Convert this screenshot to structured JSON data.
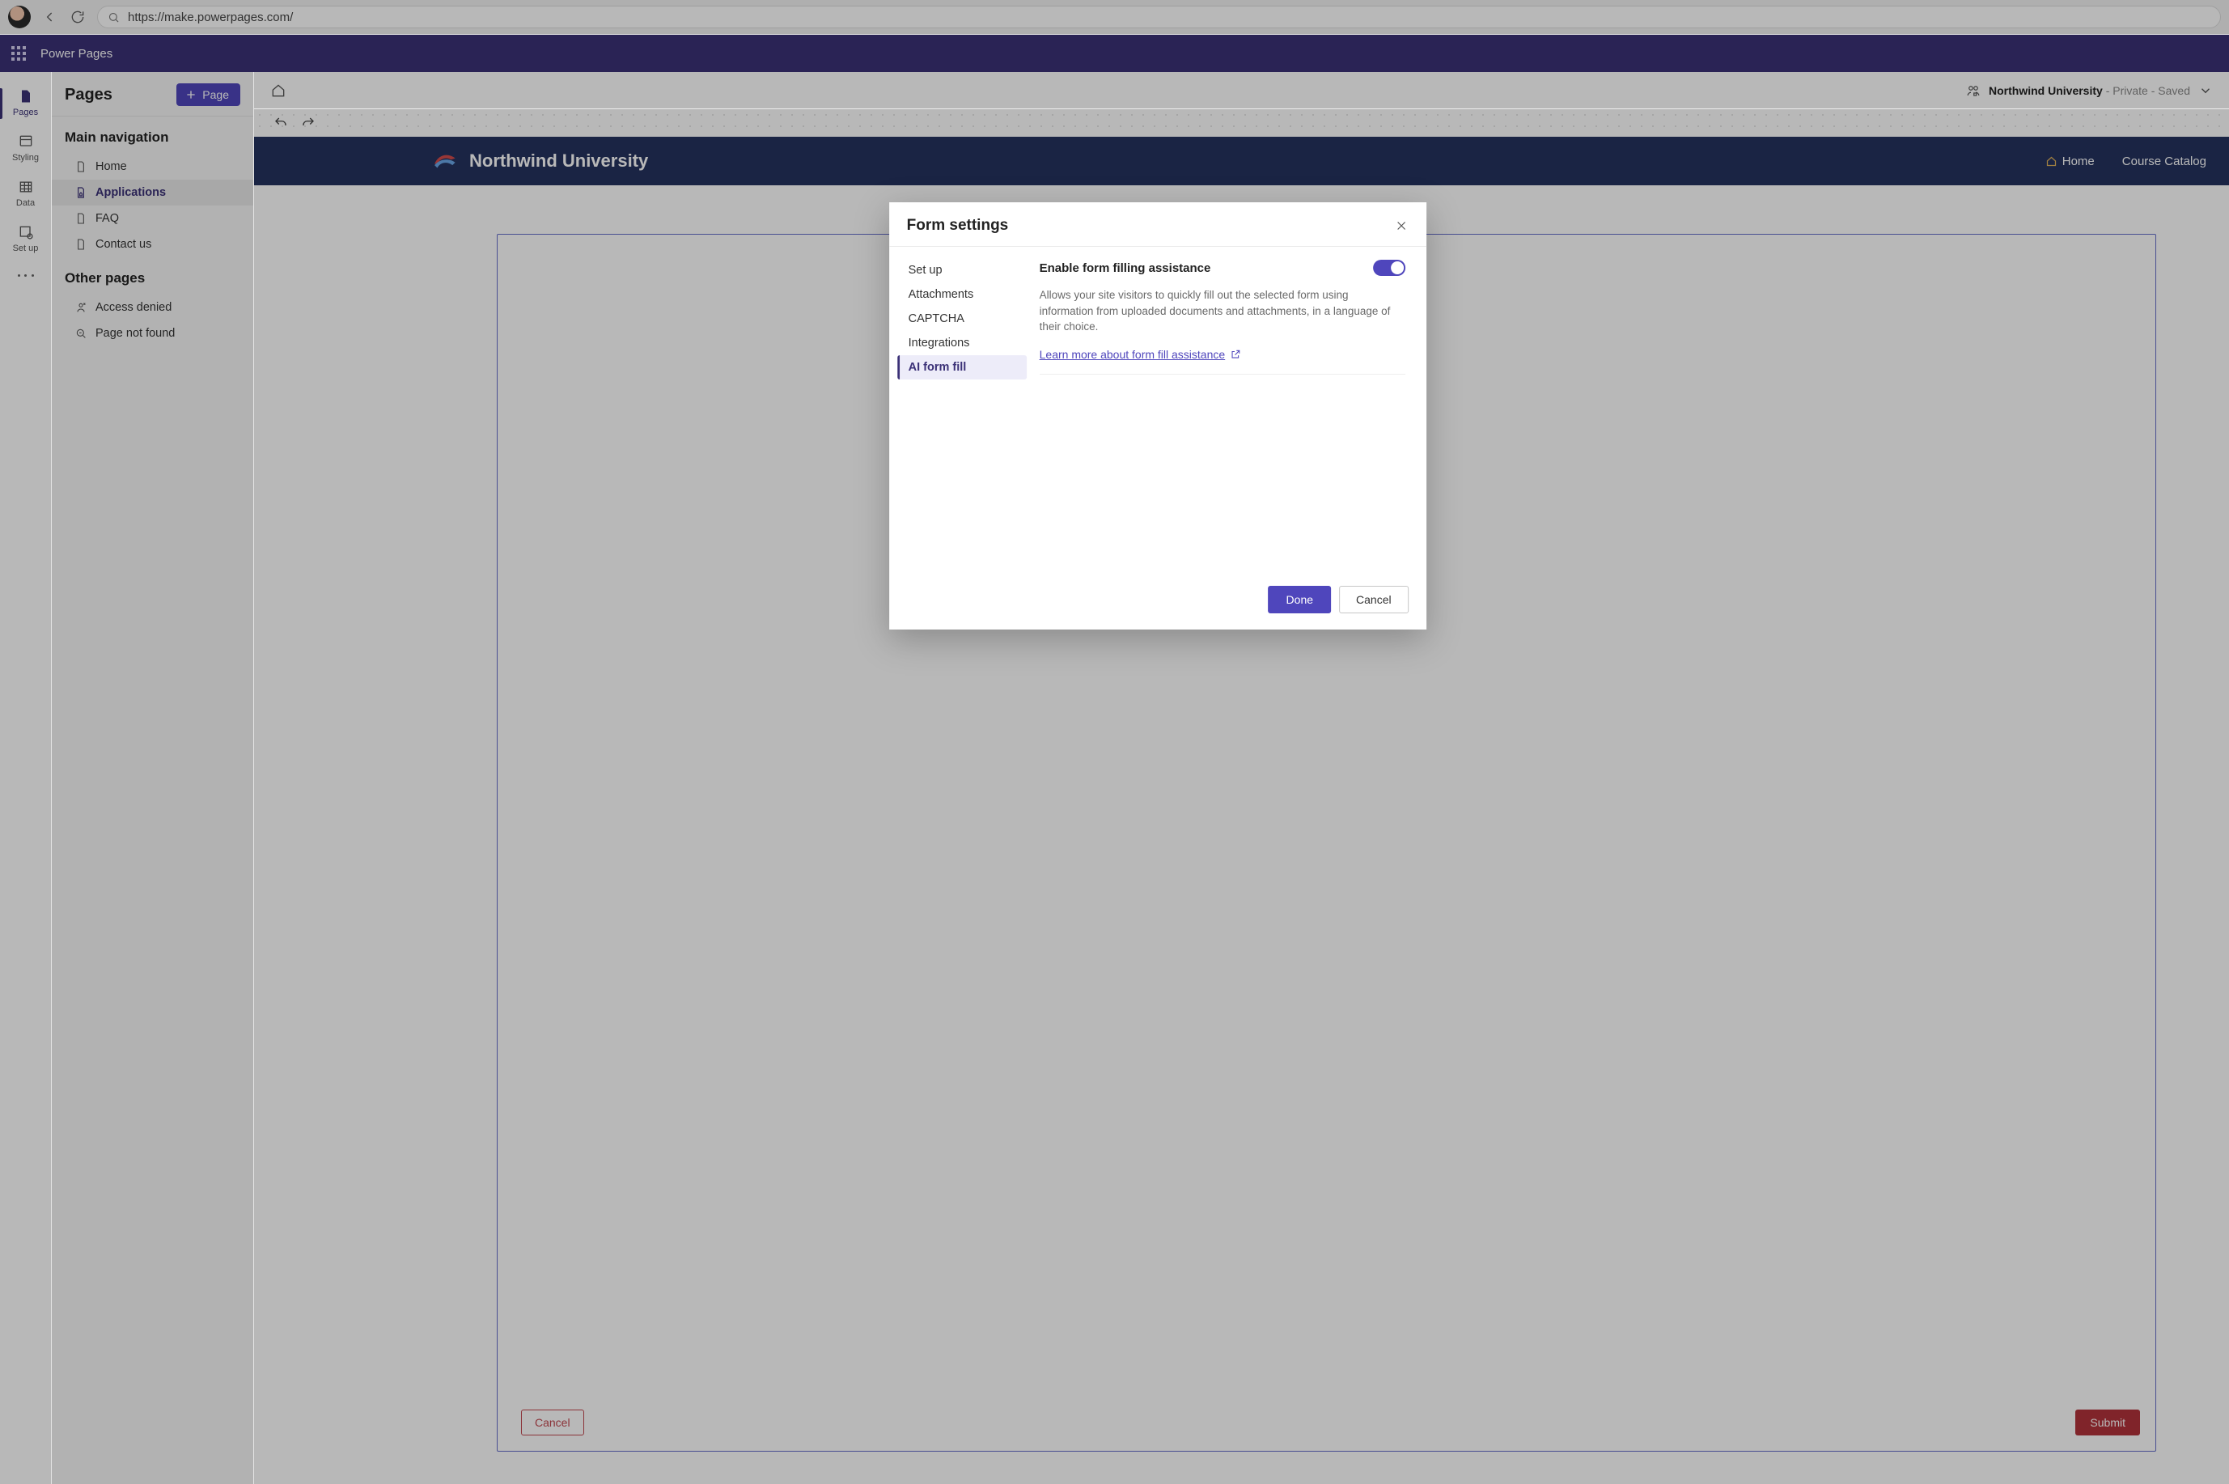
{
  "browser": {
    "url": "https://make.powerpages.com/"
  },
  "appbar": {
    "product_name": "Power Pages"
  },
  "rail": {
    "items": [
      {
        "label": "Pages"
      },
      {
        "label": "Styling"
      },
      {
        "label": "Data"
      },
      {
        "label": "Set up"
      }
    ]
  },
  "sidepanel": {
    "title": "Pages",
    "add_page_label": "Page",
    "sections": {
      "main_nav_title": "Main navigation",
      "main_items": [
        {
          "label": "Home"
        },
        {
          "label": "Applications"
        },
        {
          "label": "FAQ"
        },
        {
          "label": "Contact us"
        }
      ],
      "other_title": "Other pages",
      "other_items": [
        {
          "label": "Access denied"
        },
        {
          "label": "Page not found"
        }
      ]
    }
  },
  "canvas_top": {
    "site_name": "Northwind University",
    "visibility": "Private",
    "save_state": "Saved"
  },
  "preview": {
    "brand_title": "Northwind University",
    "nav_home": "Home",
    "nav_catalog": "Course Catalog",
    "form_cancel": "Cancel",
    "form_submit": "Submit"
  },
  "modal": {
    "title": "Form settings",
    "nav": [
      "Set up",
      "Attachments",
      "CAPTCHA",
      "Integrations",
      "AI form fill"
    ],
    "content": {
      "toggle_label": "Enable form filling assistance",
      "description": "Allows your site visitors to quickly fill out the selected form using information from uploaded documents and attachments, in a language of their choice.",
      "learn_more": "Learn more about form fill assistance"
    },
    "footer": {
      "done": "Done",
      "cancel": "Cancel"
    }
  }
}
